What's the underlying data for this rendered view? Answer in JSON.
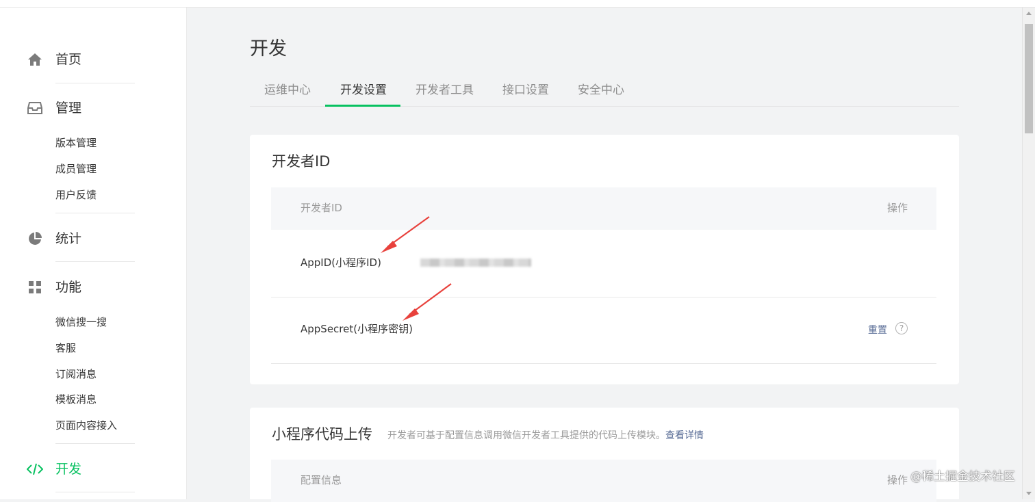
{
  "sidebar": {
    "sections": [
      {
        "label": "首页",
        "icon": "home-icon",
        "items": []
      },
      {
        "label": "管理",
        "icon": "inbox-icon",
        "items": [
          "版本管理",
          "成员管理",
          "用户反馈"
        ]
      },
      {
        "label": "统计",
        "icon": "pie-chart-icon",
        "items": []
      },
      {
        "label": "功能",
        "icon": "grid-icon",
        "items": [
          "微信搜一搜",
          "客服",
          "订阅消息",
          "模板消息",
          "页面内容接入"
        ]
      },
      {
        "label": "开发",
        "icon": "code-icon",
        "items": [],
        "active": true
      }
    ]
  },
  "main": {
    "title": "开发",
    "tabs": [
      {
        "label": "运维中心",
        "active": false
      },
      {
        "label": "开发设置",
        "active": true
      },
      {
        "label": "开发者工具",
        "active": false
      },
      {
        "label": "接口设置",
        "active": false
      },
      {
        "label": "安全中心",
        "active": false
      }
    ],
    "dev_id_card": {
      "title": "开发者ID",
      "headers": [
        "开发者ID",
        "操作"
      ],
      "rows": [
        {
          "label": "AppID(小程序ID)"
        },
        {
          "label": "AppSecret(小程序密钥)",
          "action": "重置",
          "help": "?"
        }
      ]
    },
    "upload_card": {
      "title": "小程序代码上传",
      "description": "开发者可基于配置信息调用微信开发者工具提供的代码上传模块。",
      "link": "查看详情",
      "headers": [
        "配置信息",
        "操作"
      ]
    }
  },
  "watermark": "@稀土掘金技术社区",
  "colors": {
    "accent": "#07c160",
    "link": "#576b95",
    "annotation_arrow": "#e8413c"
  }
}
